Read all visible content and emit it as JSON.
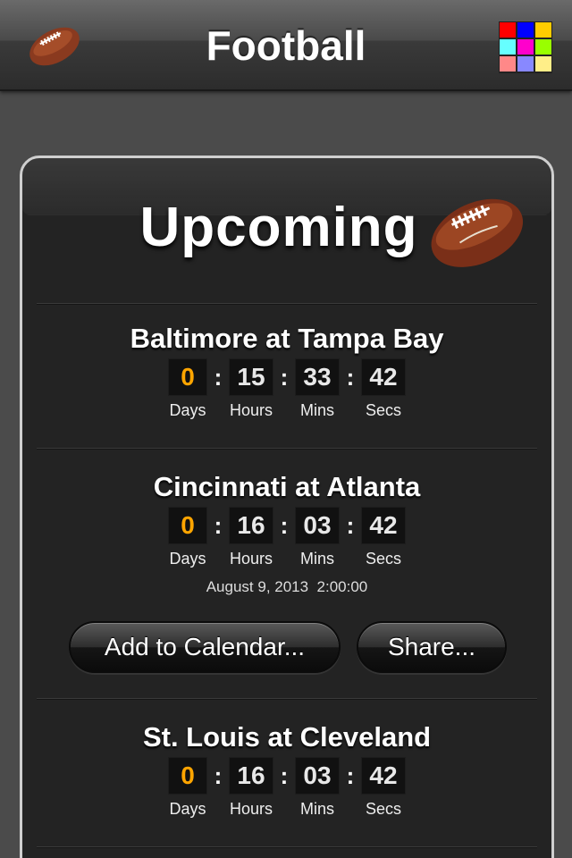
{
  "nav": {
    "title": "Football",
    "ball_icon": "football-icon",
    "palette_icon": "color-palette-icon",
    "palette_colors": [
      "#ff0000",
      "#0000ff",
      "#ffcc00",
      "#66ffff",
      "#ff00cc",
      "#99ff00",
      "#ff8888",
      "#8888ff",
      "#ffee88"
    ]
  },
  "card": {
    "title": "Upcoming",
    "ball_icon": "football-icon"
  },
  "games": [
    {
      "title": "Baltimore at Tampa Bay",
      "days": "0",
      "hours": "15",
      "mins": "33",
      "secs": "42",
      "labels": {
        "days": "Days",
        "hours": "Hours",
        "mins": "Mins",
        "secs": "Secs"
      }
    },
    {
      "title": "Cincinnati at Atlanta",
      "days": "0",
      "hours": "16",
      "mins": "03",
      "secs": "42",
      "labels": {
        "days": "Days",
        "hours": "Hours",
        "mins": "Mins",
        "secs": "Secs"
      },
      "date": "August 9, 2013  2:00:00",
      "buttons": {
        "calendar": "Add to Calendar...",
        "share": "Share..."
      }
    },
    {
      "title": "St. Louis at Cleveland",
      "days": "0",
      "hours": "16",
      "mins": "03",
      "secs": "42",
      "labels": {
        "days": "Days",
        "hours": "Hours",
        "mins": "Mins",
        "secs": "Secs"
      }
    }
  ],
  "colors": {
    "days_digit": "#ffa500",
    "background": "#4b4b4b",
    "card": "#232323"
  }
}
